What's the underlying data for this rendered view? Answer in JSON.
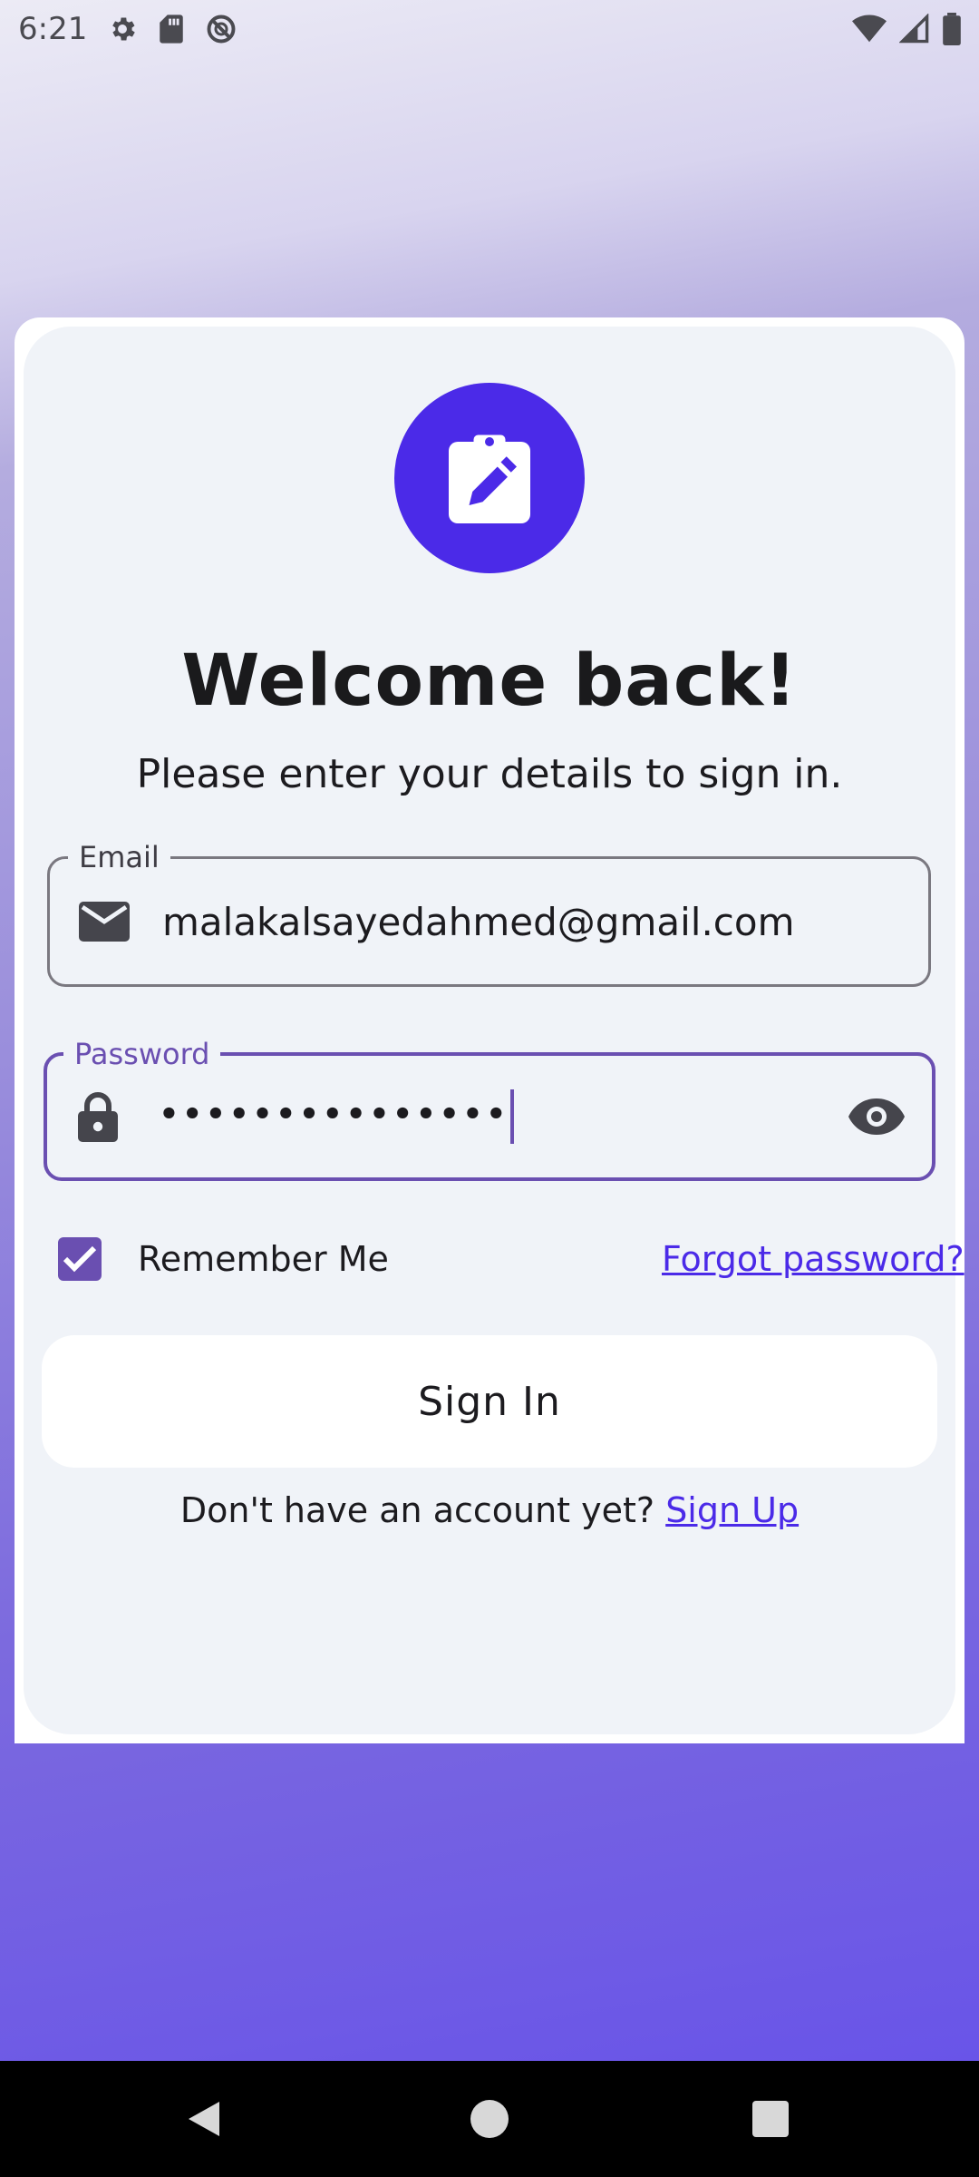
{
  "status_bar": {
    "time": "6:21",
    "icons": [
      "gear-icon",
      "sd-card-icon",
      "no-sync-icon",
      "wifi-icon",
      "signal-icon",
      "battery-icon"
    ]
  },
  "logo": {
    "icon": "clipboard-edit-icon",
    "color": "#4b2ae8"
  },
  "title": "Welcome back!",
  "subtitle": "Please enter your details to sign in.",
  "email_field": {
    "label": "Email",
    "value": "malakalsayedahmed@gmail.com",
    "icon": "mail-icon"
  },
  "password_field": {
    "label": "Password",
    "value": "•••••••••••••••",
    "icon": "lock-icon",
    "toggle_icon": "eye-icon",
    "focused": true
  },
  "remember_me": {
    "label": "Remember Me",
    "checked": true
  },
  "forgot_password": "Forgot password?",
  "sign_in_button": "Sign In",
  "signup_prompt": {
    "text": "Don't have an account yet?",
    "link": "Sign Up"
  },
  "colors": {
    "accent": "#4b2ae8",
    "focus": "#6a4fb1",
    "card": "#f0f3f8"
  }
}
